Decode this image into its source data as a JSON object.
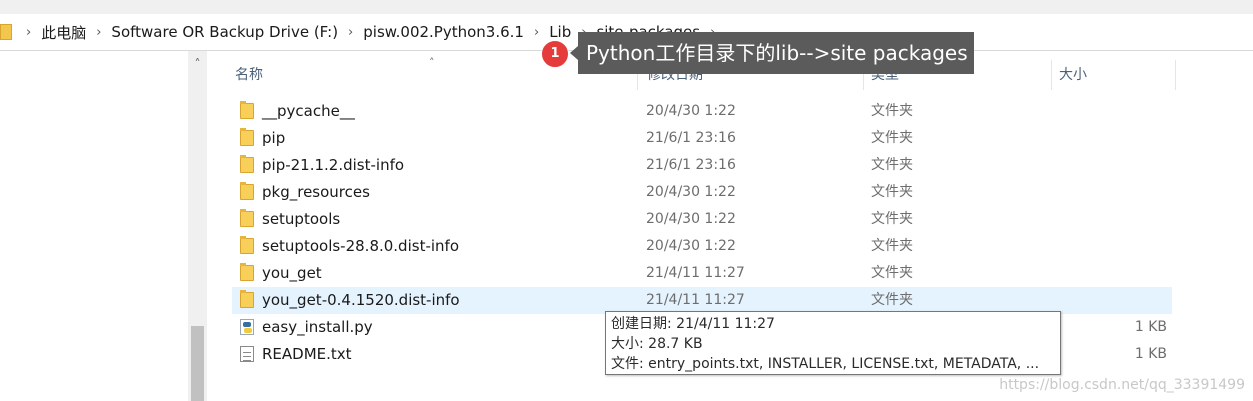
{
  "breadcrumb": {
    "items": [
      {
        "label": "此电脑"
      },
      {
        "label": "Software OR Backup Drive (F:)"
      },
      {
        "label": "pisw.002.Python3.6.1"
      },
      {
        "label": "Lib"
      },
      {
        "label": "site-packages"
      }
    ],
    "separator": "›"
  },
  "columns": {
    "name": "名称",
    "modified": "修改日期",
    "type": "类型",
    "size": "大小"
  },
  "files": [
    {
      "name": "__pycache__",
      "modified": "20/4/30 1:22",
      "type": "文件夹",
      "size": "",
      "icon": "folder-icon"
    },
    {
      "name": "pip",
      "modified": "21/6/1 23:16",
      "type": "文件夹",
      "size": "",
      "icon": "folder-icon"
    },
    {
      "name": "pip-21.1.2.dist-info",
      "modified": "21/6/1 23:16",
      "type": "文件夹",
      "size": "",
      "icon": "folder-icon"
    },
    {
      "name": "pkg_resources",
      "modified": "20/4/30 1:22",
      "type": "文件夹",
      "size": "",
      "icon": "folder-icon"
    },
    {
      "name": "setuptools",
      "modified": "20/4/30 1:22",
      "type": "文件夹",
      "size": "",
      "icon": "folder-icon"
    },
    {
      "name": "setuptools-28.8.0.dist-info",
      "modified": "20/4/30 1:22",
      "type": "文件夹",
      "size": "",
      "icon": "folder-icon"
    },
    {
      "name": "you_get",
      "modified": "21/4/11 11:27",
      "type": "文件夹",
      "size": "",
      "icon": "folder-icon"
    },
    {
      "name": "you_get-0.4.1520.dist-info",
      "modified": "21/4/11 11:27",
      "type": "文件夹",
      "size": "",
      "icon": "folder-icon"
    },
    {
      "name": "easy_install.py",
      "modified": "",
      "type": "",
      "size": "1 KB",
      "icon": "python-file-icon"
    },
    {
      "name": "README.txt",
      "modified": "",
      "type": "",
      "size": "1 KB",
      "icon": "text-file-icon"
    }
  ],
  "callout": {
    "badge": "1",
    "text": "Python工作目录下的lib-->site packages",
    "badge_color": "#e53b3b",
    "bg_color": "#5b5b5b"
  },
  "tooltip": {
    "line1": "创建日期: 21/4/11 11:27",
    "line2": "大小: 28.7 KB",
    "line3": "文件: entry_points.txt, INSTALLER, LICENSE.txt, METADATA, ..."
  },
  "watermark": "https://blog.csdn.net/qq_33391499",
  "colors": {
    "selected_row": "#e5f3ff",
    "header_text": "#4c607a",
    "folder": "#f7cf59"
  }
}
